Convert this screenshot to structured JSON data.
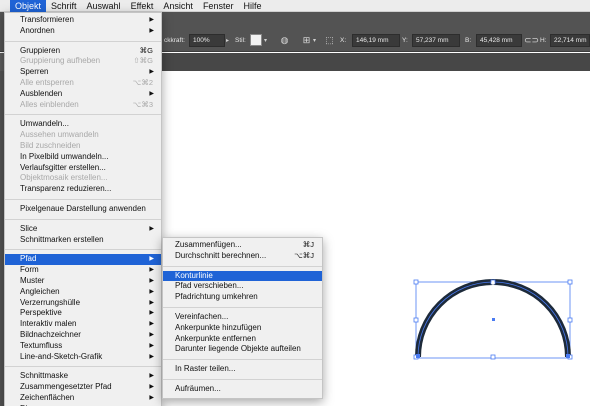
{
  "menubar": {
    "items": [
      {
        "label": "Objekt",
        "active": true
      },
      {
        "label": "Schrift",
        "active": false
      },
      {
        "label": "Auswahl",
        "active": false
      },
      {
        "label": "Effekt",
        "active": false
      },
      {
        "label": "Ansicht",
        "active": false
      },
      {
        "label": "Fenster",
        "active": false
      },
      {
        "label": "Hilfe",
        "active": false
      }
    ]
  },
  "controlbar": {
    "opacity_label": "ckkraft:",
    "opacity_value": "100%",
    "style_label": "Stil:",
    "x_label": "X:",
    "x_value": "146,19 mm",
    "y_label": "Y:",
    "y_value": "57,237 mm",
    "b_label": "B:",
    "b_value": "45,428 mm",
    "h_label": "H:",
    "h_value": "22,714 mm"
  },
  "main_menu": {
    "groups": [
      [
        {
          "label": "Transformieren",
          "submenu": true
        },
        {
          "label": "Anordnen",
          "submenu": true
        }
      ],
      [
        {
          "label": "Gruppieren",
          "shortcut": "⌘G"
        },
        {
          "label": "Gruppierung aufheben",
          "shortcut": "⇧⌘G",
          "disabled": true
        },
        {
          "label": "Sperren",
          "submenu": true
        },
        {
          "label": "Alle entsperren",
          "shortcut": "⌥⌘2",
          "disabled": true
        },
        {
          "label": "Ausblenden",
          "submenu": true
        },
        {
          "label": "Alles einblenden",
          "shortcut": "⌥⌘3",
          "disabled": true
        }
      ],
      [
        {
          "label": "Umwandeln..."
        },
        {
          "label": "Aussehen umwandeln",
          "disabled": true
        },
        {
          "label": "Bild zuschneiden",
          "disabled": true
        },
        {
          "label": "In Pixelbild umwandeln..."
        },
        {
          "label": "Verlaufsgitter erstellen..."
        },
        {
          "label": "Objektmosaik erstellen...",
          "disabled": true
        },
        {
          "label": "Transparenz reduzieren..."
        }
      ],
      [
        {
          "label": "Pixelgenaue Darstellung anwenden"
        }
      ],
      [
        {
          "label": "Slice",
          "submenu": true
        },
        {
          "label": "Schnittmarken erstellen"
        }
      ],
      [
        {
          "label": "Pfad",
          "submenu": true,
          "highlight": true
        },
        {
          "label": "Form",
          "submenu": true
        },
        {
          "label": "Muster",
          "submenu": true
        },
        {
          "label": "Angleichen",
          "submenu": true
        },
        {
          "label": "Verzerrungshülle",
          "submenu": true
        },
        {
          "label": "Perspektive",
          "submenu": true
        },
        {
          "label": "Interaktiv malen",
          "submenu": true
        },
        {
          "label": "Bildnachzeichner",
          "submenu": true
        },
        {
          "label": "Textumfluss",
          "submenu": true
        },
        {
          "label": "Line-and-Sketch-Grafik",
          "submenu": true
        }
      ],
      [
        {
          "label": "Schnittmaske",
          "submenu": true
        },
        {
          "label": "Zusammengesetzter Pfad",
          "submenu": true
        },
        {
          "label": "Zeichenflächen",
          "submenu": true
        },
        {
          "label": "Diagramm",
          "submenu": true
        }
      ]
    ]
  },
  "path_submenu": {
    "groups": [
      [
        {
          "label": "Zusammenfügen...",
          "shortcut": "⌘J"
        },
        {
          "label": "Durchschnitt berechnen...",
          "shortcut": "⌥⌘J"
        }
      ],
      [
        {
          "label": "Konturlinie",
          "highlight": true
        },
        {
          "label": "Pfad verschieben..."
        },
        {
          "label": "Pfadrichtung umkehren"
        }
      ],
      [
        {
          "label": "Vereinfachen..."
        },
        {
          "label": "Ankerpunkte hinzufügen"
        },
        {
          "label": "Ankerpunkte entfernen"
        },
        {
          "label": "Darunter liegende Objekte aufteilen"
        }
      ],
      [
        {
          "label": "In Raster teilen..."
        }
      ],
      [
        {
          "label": "Aufräumen..."
        }
      ]
    ]
  },
  "colors": {
    "accent": "#1f63d6",
    "selection": "#4a7bf2",
    "stroke_dark": "#1d2a3a",
    "stroke_inner": "#3f4e66"
  }
}
